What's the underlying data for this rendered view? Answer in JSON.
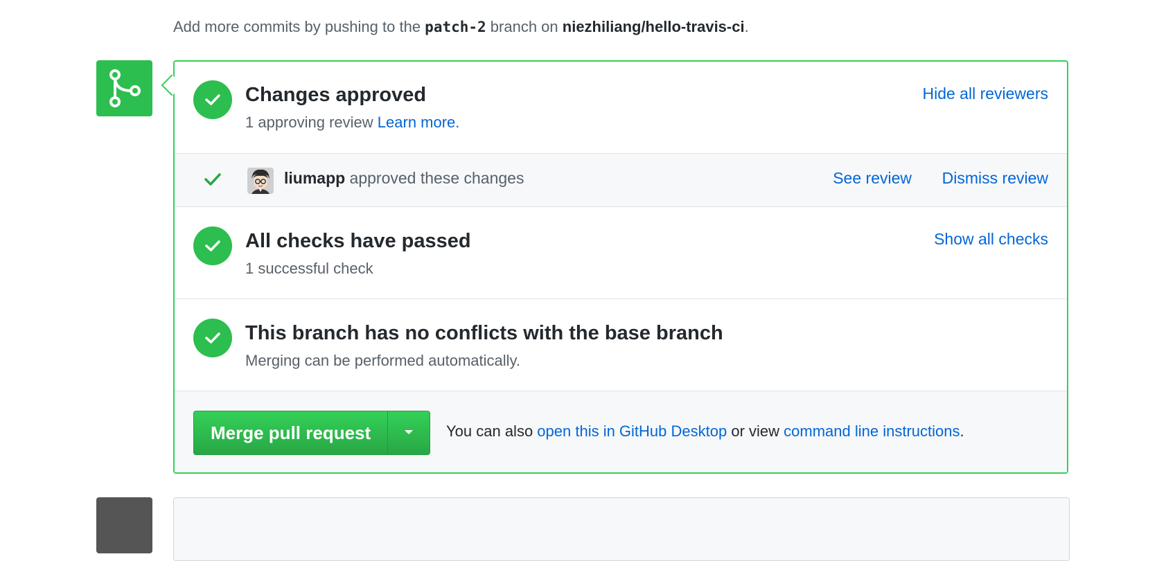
{
  "top_note": {
    "prefix": "Add more commits by pushing to the ",
    "branch": "patch-2",
    "middle": " branch on ",
    "repo": "niezhiliang/hello-travis-ci",
    "suffix": "."
  },
  "approved": {
    "title": "Changes approved",
    "subtitle": "1 approving review ",
    "learn_more": "Learn more.",
    "hide_reviewers": "Hide all reviewers"
  },
  "review": {
    "reviewer": "liumapp",
    "action": " approved these changes",
    "see_review": "See review",
    "dismiss_review": "Dismiss review"
  },
  "checks": {
    "title": "All checks have passed",
    "subtitle": "1 successful check",
    "show_all": "Show all checks"
  },
  "conflicts": {
    "title": "This branch has no conflicts with the base branch",
    "subtitle": "Merging can be performed automatically."
  },
  "merge": {
    "button_label": "Merge pull request",
    "note_prefix": "You can also ",
    "desktop_link": "open this in GitHub Desktop",
    "note_middle": " or view ",
    "cli_link": "command line instructions",
    "note_suffix": "."
  },
  "colors": {
    "success_green": "#2cbe4e",
    "panel_border": "#34d058",
    "link_blue": "#0366d6"
  },
  "icons": {
    "merge_status": "git-merge-icon",
    "status": "check-circle-icon",
    "review_check": "check-icon",
    "dropdown": "triangle-down-icon"
  }
}
